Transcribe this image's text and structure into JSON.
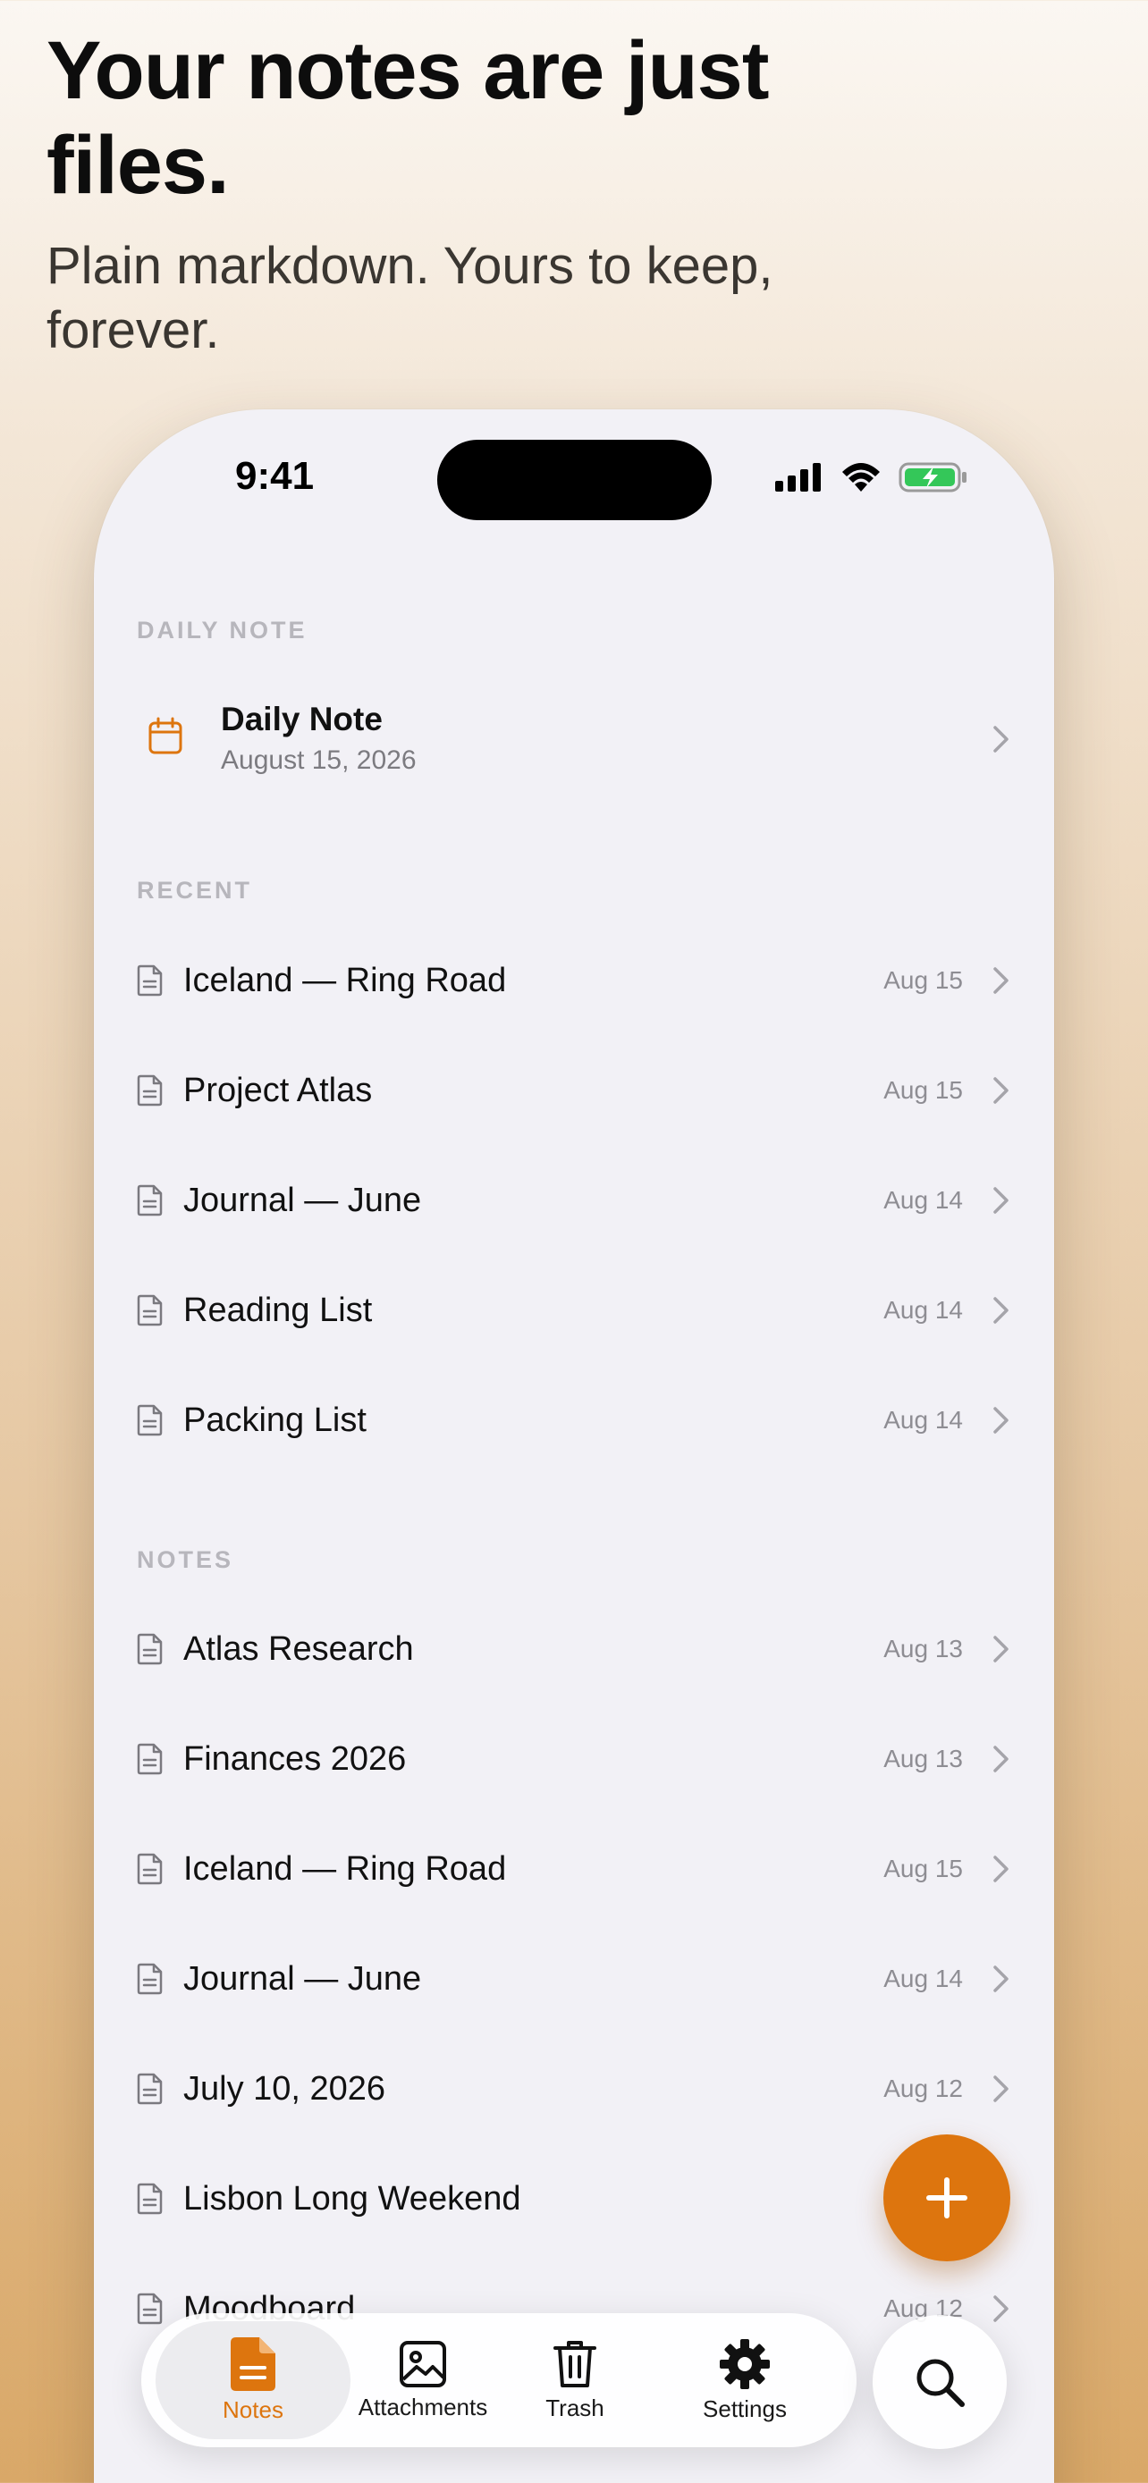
{
  "marketing": {
    "headline": "Your notes are just files.",
    "subline": "Plain markdown. Yours to keep, forever."
  },
  "status_bar": {
    "time": "9:41"
  },
  "colors": {
    "accent": "#dd750e",
    "background": "#f2f1f6"
  },
  "daily_section": {
    "label": "DAILY NOTE",
    "title": "Daily Note",
    "date": "August 15, 2026"
  },
  "recent_section": {
    "label": "RECENT",
    "items": [
      {
        "title": "Iceland — Ring Road",
        "date": "Aug 15"
      },
      {
        "title": "Project Atlas",
        "date": "Aug 15"
      },
      {
        "title": "Journal — June",
        "date": "Aug 14"
      },
      {
        "title": "Reading List",
        "date": "Aug 14"
      },
      {
        "title": "Packing List",
        "date": "Aug 14"
      }
    ]
  },
  "notes_section": {
    "label": "NOTES",
    "items": [
      {
        "title": "Atlas Research",
        "date": "Aug 13"
      },
      {
        "title": "Finances 2026",
        "date": "Aug 13"
      },
      {
        "title": "Iceland — Ring Road",
        "date": "Aug 15"
      },
      {
        "title": "Journal — June",
        "date": "Aug 14"
      },
      {
        "title": "July 10, 2026",
        "date": "Aug 12"
      },
      {
        "title": "Lisbon Long Weekend",
        "date": ""
      },
      {
        "title": "Moodboard",
        "date": "Aug 12"
      }
    ]
  },
  "tabbar": {
    "tabs": [
      {
        "label": "Notes",
        "icon": "note-icon"
      },
      {
        "label": "Attachments",
        "icon": "image-icon"
      },
      {
        "label": "Trash",
        "icon": "trash-icon"
      },
      {
        "label": "Settings",
        "icon": "gear-icon"
      }
    ]
  }
}
